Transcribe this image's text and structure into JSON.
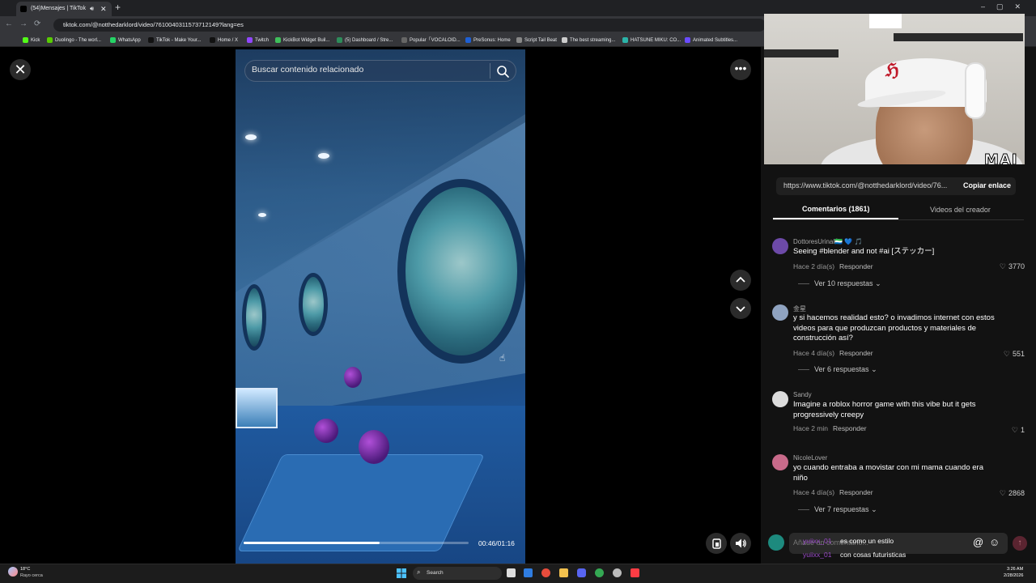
{
  "browser": {
    "tab_title": "(54)Mensajes | TikTok",
    "url": "tiktok.com/@notthedarklord/video/7610040311573712149?lang=es",
    "bookmarks": [
      "Kick",
      "Duolingo - The worl...",
      "WhatsApp",
      "TikTok - Make Your...",
      "Home / X",
      "Twitch",
      "KickBot Widget Buil...",
      "(5) Dashboard / Stre...",
      "Popular「VOCALOID...",
      "PreSonus: Home",
      "Script Tail Beat",
      "The best streaming...",
      "HATSUNE MIKU: CO...",
      "Animated Subtitles..."
    ]
  },
  "video": {
    "search_placeholder": "Buscar contenido relacionado",
    "time_display": "00:46/01:16",
    "progress_fraction": 0.605
  },
  "webcam": {
    "watermark": "MAI"
  },
  "panel": {
    "share_link": "https://www.tiktok.com/@notthedarklord/video/76...",
    "copy_link_label": "Copiar enlace",
    "tabs": {
      "comments": "Comentarios (1861)",
      "creator_videos": "Videos del creador"
    },
    "comments": [
      {
        "user": "DottoresUrinal🇸🇱 💙 🎵",
        "body": "Seeing #blender and not #ai [ステッカー]",
        "time": "Hace 2 día(s)",
        "reply": "Responder",
        "likes": "3770",
        "more_replies": "Ver 10 respuestas",
        "avatar_color": "#6d4aa8"
      },
      {
        "user": "金星",
        "body": "y si hacemos realidad esto? o invadimos internet con estos videos para que produzcan productos y materiales de construcción así?",
        "time": "Hace 4 día(s)",
        "reply": "Responder",
        "likes": "551",
        "more_replies": "Ver 6 respuestas",
        "avatar_color": "#8fa3c0"
      },
      {
        "user": "Sandy",
        "body": "Imagine a roblox horror game with this vibe but it gets progressively creepy",
        "time": "Hace 2 min",
        "reply": "Responder",
        "likes": "1",
        "more_replies": "",
        "avatar_color": "#dcdcdc"
      },
      {
        "user": "NicoleLover",
        "body": "yo cuando entraba a movistar con mi mama cuando era niño",
        "time": "Hace 4 día(s)",
        "reply": "Responder",
        "likes": "2868",
        "more_replies": "Ver 7 respuestas",
        "avatar_color": "#c86a8a"
      }
    ],
    "comment_input_placeholder": "Añade un comentario...",
    "chat_overlay": [
      {
        "user": "yuiixx_01",
        "message": "es como un estilo"
      },
      {
        "user": "yuiixx_01",
        "message": "con cosas futuristicas"
      }
    ]
  },
  "taskbar": {
    "weather_temp": "18°C",
    "weather_desc": "Rayo cerca",
    "search_label": "Search",
    "time": "3:26 AM",
    "date": "2/28/2026",
    "colors": {
      "accent_red": "#fe2c55",
      "chat_user": "#9b4ac9"
    }
  }
}
